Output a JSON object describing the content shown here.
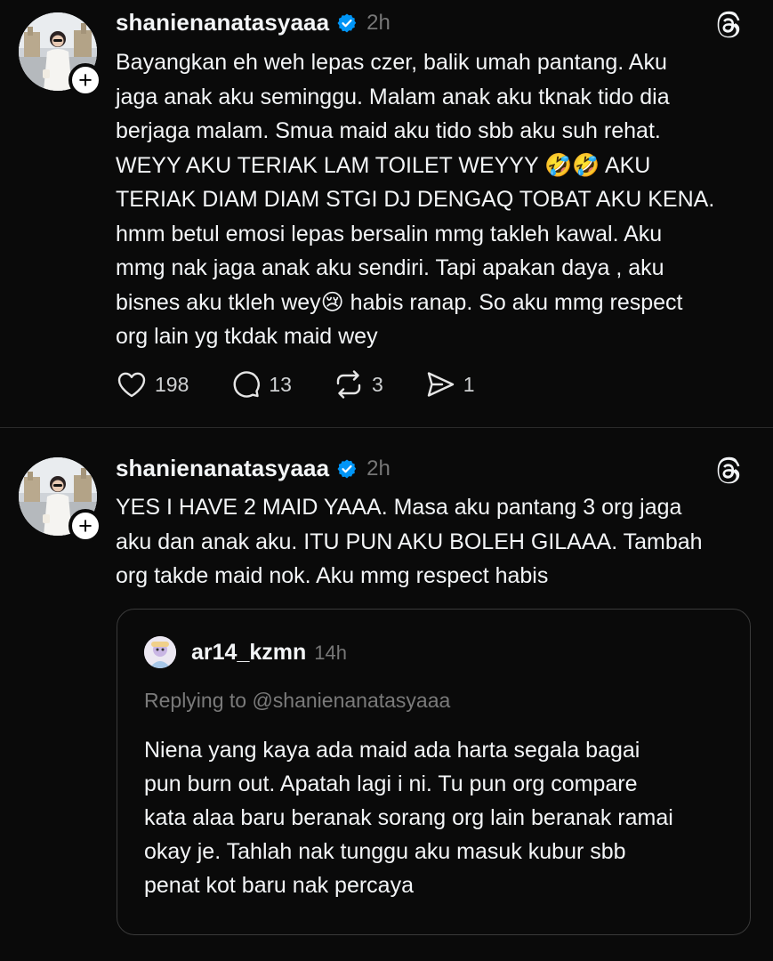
{
  "posts": [
    {
      "username": "shanienanatasyaaa",
      "time": "2h",
      "text_lines": [
        "Bayangkan eh weh lepas czer, balik umah pantang. Aku",
        "jaga anak aku seminggu. Malam anak aku tknak tido dia",
        "berjaga malam. Smua maid aku tido sbb aku suh rehat.",
        "WEYY AKU TERIAK LAM TOILET WEYYY 🤣🤣 AKU",
        "TERIAK DIAM DIAM STGI DJ DENGAQ TOBAT AKU KENA.",
        "hmm betul emosi lepas bersalin mmg takleh kawal. Aku",
        "mmg nak jaga anak aku sendiri. Tapi apakan daya , aku",
        "bisnes aku tkleh wey😢 habis ranap. So aku mmg respect",
        "org lain yg tkdak maid wey"
      ],
      "likes": "198",
      "comments": "13",
      "reposts": "3",
      "shares": "1"
    },
    {
      "username": "shanienanatasyaaa",
      "time": "2h",
      "text_lines": [
        "YES I HAVE 2 MAID YAAA. Masa aku pantang 3 org jaga",
        "aku dan anak aku. ITU PUN AKU BOLEH GILAAA. Tambah",
        "org takde maid nok. Aku mmg respect habis"
      ],
      "quote": {
        "username": "ar14_kzmn",
        "time": "14h",
        "replying_to": "Replying to @shanienanatasyaaa",
        "text_lines": [
          "Niena yang kaya ada maid ada harta segala bagai",
          "pun burn out. Apatah lagi i ni. Tu pun org compare",
          "kata alaa baru beranak sorang org lain beranak ramai",
          "okay je. Tahlah nak tunggu aku masuk kubur sbb",
          "penat kot baru nak percaya"
        ]
      }
    }
  ],
  "colors": {
    "background": "#0a0a0a",
    "text": "#f3f5f7",
    "muted": "#777777",
    "verified": "#0095f6",
    "border": "#3a3a3a"
  },
  "icons": [
    "follow-plus-icon",
    "verified-badge-icon",
    "threads-logo-icon",
    "heart-icon",
    "comment-icon",
    "repost-icon",
    "share-icon"
  ]
}
